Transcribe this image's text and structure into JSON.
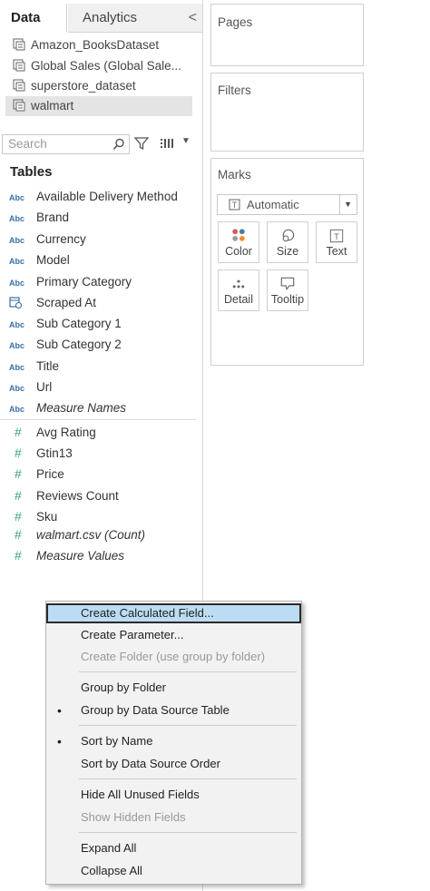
{
  "tabs": {
    "data": "Data",
    "analytics": "Analytics",
    "collapse": "<"
  },
  "datasources": [
    "Amazon_BooksDataset",
    "Global Sales (Global Sale...",
    "superstore_dataset",
    "walmart"
  ],
  "search": {
    "placeholder": "Search"
  },
  "tables_heading": "Tables",
  "dimensions": [
    {
      "type": "Abc",
      "label": "Available Delivery Method"
    },
    {
      "type": "Abc",
      "label": "Brand"
    },
    {
      "type": "Abc",
      "label": "Currency"
    },
    {
      "type": "Abc",
      "label": "Model"
    },
    {
      "type": "Abc",
      "label": "Primary Category"
    },
    {
      "type": "date",
      "label": "Scraped At"
    },
    {
      "type": "Abc",
      "label": "Sub Category 1"
    },
    {
      "type": "Abc",
      "label": "Sub Category 2"
    },
    {
      "type": "Abc",
      "label": "Title"
    },
    {
      "type": "Abc",
      "label": "Url"
    },
    {
      "type": "Abc",
      "label": "Measure Names"
    }
  ],
  "measures": [
    {
      "type": "#",
      "label": "Avg Rating"
    },
    {
      "type": "#",
      "label": "Gtin13"
    },
    {
      "type": "#",
      "label": "Price"
    },
    {
      "type": "#",
      "label": "Reviews Count"
    },
    {
      "type": "#",
      "label": "Sku"
    },
    {
      "type": "#",
      "label": "walmart.csv (Count)"
    },
    {
      "type": "#",
      "label": "Measure Values"
    }
  ],
  "cards": {
    "pages": "Pages",
    "filters": "Filters",
    "marks": "Marks"
  },
  "marks": {
    "type": "Automatic",
    "buttons": {
      "color": "Color",
      "size": "Size",
      "text": "Text",
      "detail": "Detail",
      "tooltip": "Tooltip"
    }
  },
  "context_menu": {
    "items": [
      {
        "label": "Create Calculated Field...",
        "enabled": true,
        "highlighted": true
      },
      {
        "label": "Create Parameter...",
        "enabled": true
      },
      {
        "label": "Create Folder (use group by folder)",
        "enabled": false
      },
      {
        "label": "Group by Folder",
        "enabled": true
      },
      {
        "label": "Group by Data Source Table",
        "enabled": true,
        "checked": true
      },
      {
        "label": "Sort by Name",
        "enabled": true,
        "checked": true
      },
      {
        "label": "Sort by Data Source Order",
        "enabled": true
      },
      {
        "label": "Hide All Unused Fields",
        "enabled": true
      },
      {
        "label": "Show Hidden Fields",
        "enabled": false
      },
      {
        "label": "Expand All",
        "enabled": true
      },
      {
        "label": "Collapse All",
        "enabled": true
      }
    ],
    "bullet": "•"
  }
}
